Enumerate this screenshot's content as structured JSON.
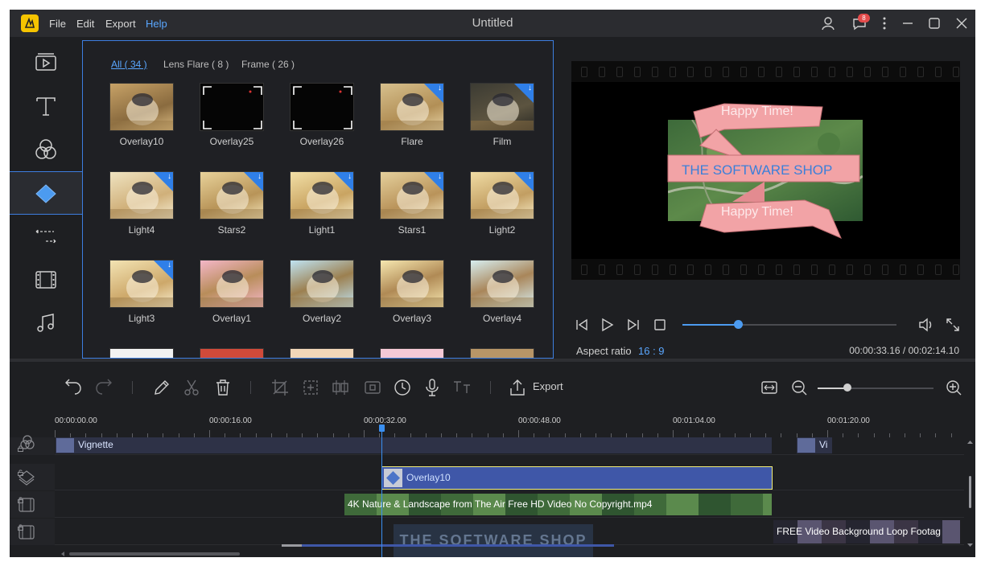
{
  "titlebar": {
    "title": "Untitled",
    "menus": [
      "File",
      "Edit",
      "Export",
      "Help"
    ],
    "active_menu": "Help",
    "notification_count": "8"
  },
  "library": {
    "tabs": [
      "All ( 34 )",
      "Lens Flare ( 8 )",
      "Frame ( 26 )"
    ],
    "items": [
      {
        "label": "Overlay10",
        "downloadable": false
      },
      {
        "label": "Overlay25",
        "downloadable": false
      },
      {
        "label": "Overlay26",
        "downloadable": false
      },
      {
        "label": "Flare",
        "downloadable": true
      },
      {
        "label": "Film",
        "downloadable": true
      },
      {
        "label": "Light4",
        "downloadable": true
      },
      {
        "label": "Stars2",
        "downloadable": true
      },
      {
        "label": "Light1",
        "downloadable": true
      },
      {
        "label": "Stars1",
        "downloadable": true
      },
      {
        "label": "Light2",
        "downloadable": true
      },
      {
        "label": "Light3",
        "downloadable": true
      },
      {
        "label": "Overlay1",
        "downloadable": false
      },
      {
        "label": "Overlay2",
        "downloadable": false
      },
      {
        "label": "Overlay3",
        "downloadable": false
      },
      {
        "label": "Overlay4",
        "downloadable": false
      }
    ]
  },
  "preview": {
    "banner_top": "Happy Time!",
    "banner_mid": "THE SOFTWARE SHOP",
    "banner_bottom": "Happy Time!",
    "aspect_label": "Aspect ratio",
    "aspect_value": "16 : 9",
    "time": "00:00:33.16 / 00:02:14.10",
    "progress": 0.26
  },
  "toolbar": {
    "export_label": "Export",
    "zoom_level": 0.26
  },
  "timeline": {
    "ruler": [
      "00:00:00.00",
      "00:00:16.00",
      "00:00:32.00",
      "00:00:48.00",
      "00:01:04.00",
      "00:01:20.00"
    ],
    "clips": {
      "effect": "Vignette",
      "effect_short": "Vi",
      "overlay": "Overlay10",
      "video1": "4K Nature & Landscape from The Air Free HD Video No Copyright.mp4",
      "video2": "FREE Video Background Loop Footag"
    },
    "watermark": "THE SOFTWARE SHOP"
  }
}
